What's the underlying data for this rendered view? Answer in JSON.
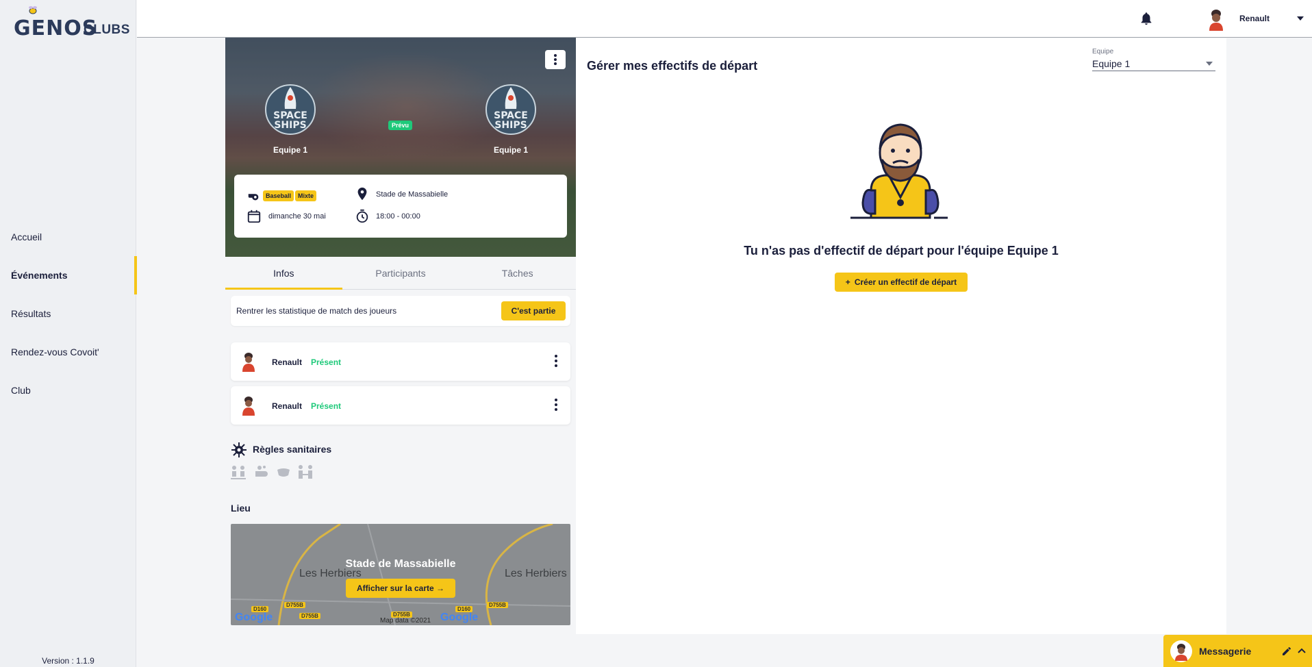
{
  "app": {
    "logo_main": "GENOS",
    "logo_sub": "CLUBS",
    "version": "Version : 1.1.9"
  },
  "sidebar": {
    "items": [
      {
        "label": "Accueil"
      },
      {
        "label": "Événements"
      },
      {
        "label": "Résultats"
      },
      {
        "label": "Rendez-vous Covoit'"
      },
      {
        "label": "Club"
      }
    ]
  },
  "topbar": {
    "user_name": "Renault",
    "icons": [
      "bell-icon",
      "avatar",
      "chevron-down-icon"
    ]
  },
  "event": {
    "home_team": "Equipe 1",
    "away_team": "Equipe 1",
    "team_logo_text": [
      "SPACE",
      "SHIPS"
    ],
    "status": "Prévu",
    "tags": [
      "Baseball",
      "Mixte"
    ],
    "date": "dimanche 30 mai",
    "location": "Stade de Massabielle",
    "time": "18:00  - 00:00"
  },
  "tabs": [
    {
      "label": "Infos"
    },
    {
      "label": "Participants"
    },
    {
      "label": "Tâches"
    }
  ],
  "stats": {
    "text": "Rentrer les statistique de match des joueurs",
    "button": "C'est partie"
  },
  "participants": [
    {
      "name": "Renault",
      "status": "Présent"
    },
    {
      "name": "Renault",
      "status": "Présent"
    }
  ],
  "rules": {
    "title": "Règles sanitaires",
    "icons": [
      "distancing-icon",
      "hand-wash-icon",
      "mask-icon",
      "spacing-icon"
    ]
  },
  "lieu": {
    "title": "Lieu",
    "map_name": "Stade de Massabielle",
    "map_button": "Afficher sur la carte",
    "map_labels": [
      "Les Herbiers",
      "Les Herbiers"
    ],
    "roads": [
      "D160",
      "D755B",
      "D755B",
      "D160",
      "D755B",
      "D755B"
    ],
    "map_data": "Map data ©2021",
    "google": "Google"
  },
  "panel": {
    "title": "Gérer mes effectifs de départ",
    "select_label": "Equipe",
    "select_value": "Equipe 1",
    "empty_text": "Tu n'as pas d'effectif de départ pour l'équipe Equipe 1",
    "create_button": "Créer un effectif de départ"
  },
  "messagerie": {
    "label": "Messagerie"
  },
  "colors": {
    "accent": "#f5c518",
    "present": "#1ec97a",
    "text": "#1b1f3b"
  }
}
